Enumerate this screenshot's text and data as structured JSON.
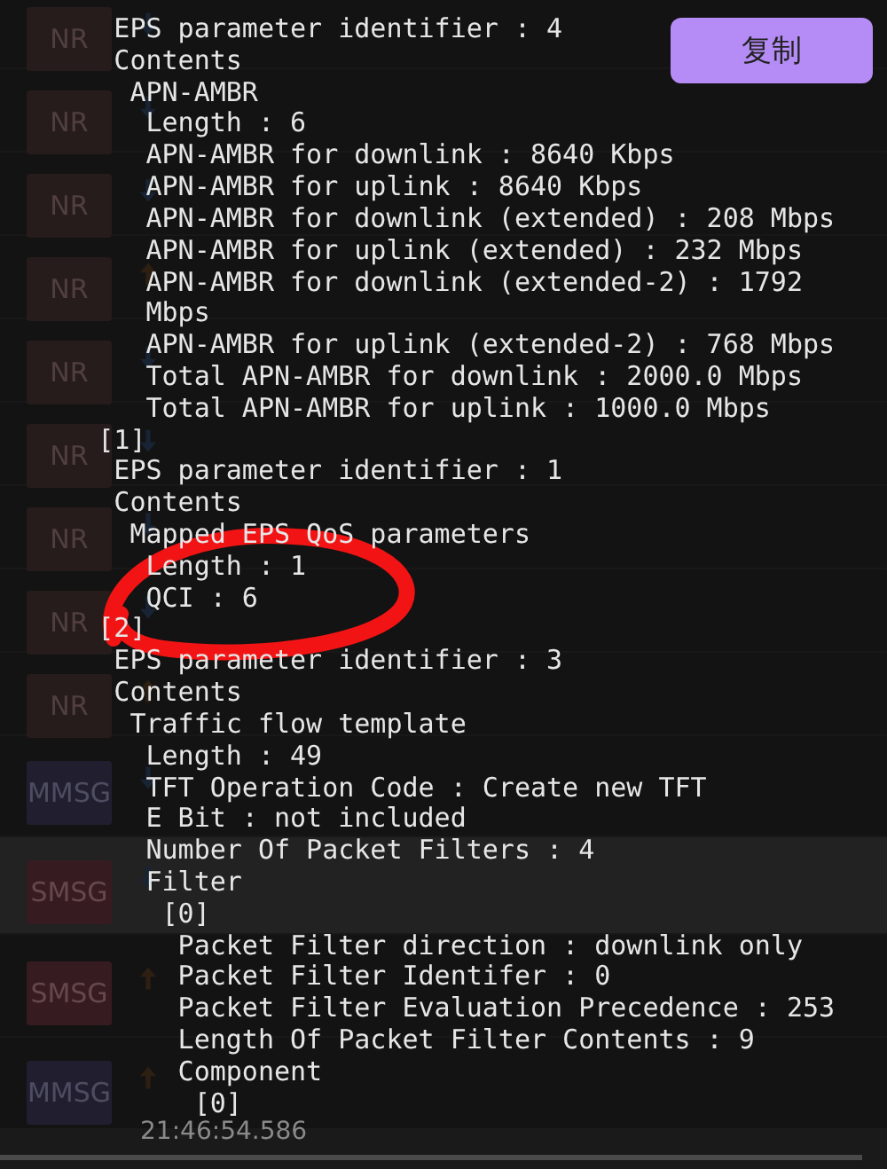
{
  "message_list": [
    {
      "kind": "nr",
      "badge": "NR",
      "uplink": false,
      "selected": false
    },
    {
      "kind": "nr",
      "badge": "NR",
      "uplink": false,
      "selected": false
    },
    {
      "kind": "nr",
      "badge": "NR",
      "uplink": false,
      "selected": false
    },
    {
      "kind": "nr",
      "badge": "NR",
      "uplink": true,
      "selected": false
    },
    {
      "kind": "nr",
      "badge": "NR",
      "uplink": false,
      "selected": false
    },
    {
      "kind": "nr",
      "badge": "NR",
      "uplink": false,
      "selected": false
    },
    {
      "kind": "nr",
      "badge": "NR",
      "uplink": false,
      "selected": false
    },
    {
      "kind": "nr",
      "badge": "NR",
      "uplink": false,
      "selected": false
    },
    {
      "kind": "nr",
      "badge": "NR",
      "uplink": true,
      "selected": false
    },
    {
      "kind": "mmsg",
      "badge": "MMSG",
      "uplink": false,
      "selected": false
    },
    {
      "kind": "smsg",
      "badge": "SMSG",
      "uplink": false,
      "selected": true
    },
    {
      "kind": "smsg",
      "badge": "SMSG",
      "uplink": true,
      "selected": false
    },
    {
      "kind": "mmsg",
      "badge": "MMSG",
      "uplink": true,
      "selected": false,
      "time": "21:46:54.586"
    }
  ],
  "detail_popup": {
    "copy_button": "复制",
    "markup": [
      {
        "kind": "ellipse"
      }
    ],
    "tree": [
      {
        "children": [
          {
            "text": "EPS parameter identifier : 4"
          },
          {
            "text": "Contents",
            "children": [
              {
                "text": "APN-AMBR",
                "children": [
                  {
                    "text": "Length : 6"
                  },
                  {
                    "text": "APN-AMBR for downlink : 8640 Kbps"
                  },
                  {
                    "text": "APN-AMBR for uplink : 8640 Kbps"
                  },
                  {
                    "text": "APN-AMBR for downlink (extended) : 208 Mbps"
                  },
                  {
                    "text": "APN-AMBR for uplink (extended) : 232 Mbps"
                  },
                  {
                    "text": "APN-AMBR for downlink (extended-2) : 1792 Mbps"
                  },
                  {
                    "text": "APN-AMBR for uplink (extended-2) : 768 Mbps"
                  },
                  {
                    "text": "Total APN-AMBR for downlink : 2000.0 Mbps"
                  },
                  {
                    "text": "Total APN-AMBR for uplink : 1000.0 Mbps"
                  }
                ]
              }
            ]
          }
        ]
      },
      {
        "text": "[1]",
        "children": [
          {
            "text": "EPS parameter identifier : 1"
          },
          {
            "text": "Contents",
            "children": [
              {
                "text": "Mapped EPS QoS parameters",
                "children": [
                  {
                    "text": "Length : 1"
                  },
                  {
                    "text": "QCI : 6"
                  }
                ]
              }
            ]
          }
        ]
      },
      {
        "text": "[2]",
        "children": [
          {
            "text": "EPS parameter identifier : 3"
          },
          {
            "text": "Contents",
            "children": [
              {
                "text": "Traffic flow template",
                "children": [
                  {
                    "text": "Length : 49"
                  },
                  {
                    "text": "TFT Operation Code : Create new TFT"
                  },
                  {
                    "text": "E Bit : not included"
                  },
                  {
                    "text": "Number Of Packet Filters : 4"
                  },
                  {
                    "text": "Filter",
                    "children": [
                      {
                        "text": "[0]",
                        "children": [
                          {
                            "text": "Packet Filter direction : downlink only"
                          },
                          {
                            "text": "Packet Filter Identifer : 0"
                          },
                          {
                            "text": "Packet Filter Evaluation Precedence : 253"
                          },
                          {
                            "text": "Length Of Packet Filter Contents : 9"
                          },
                          {
                            "text": "Component",
                            "children": [
                              {
                                "text": "[0]"
                              }
                            ]
                          }
                        ]
                      }
                    ]
                  }
                ]
              }
            ]
          }
        ]
      }
    ]
  }
}
